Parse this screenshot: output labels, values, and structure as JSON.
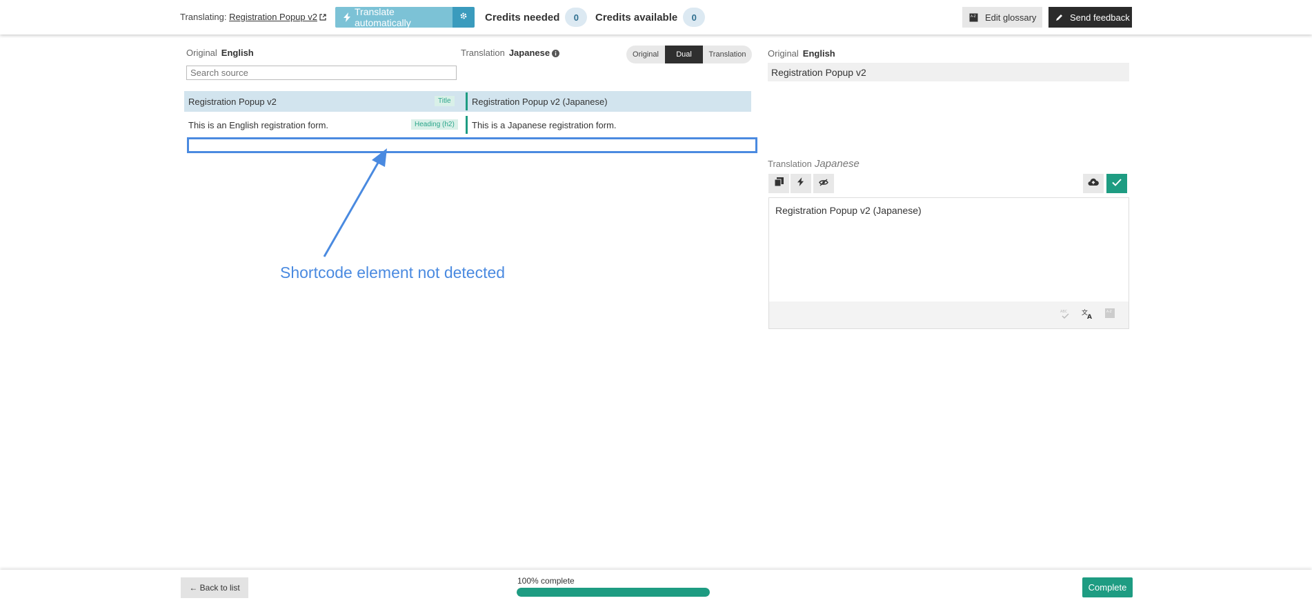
{
  "header": {
    "translating_label": "Translating:",
    "doc_title": "Registration Popup v2",
    "translate_auto_label": "Translate automatically",
    "credits_needed_label": "Credits needed",
    "credits_needed_value": "0",
    "credits_available_label": "Credits available",
    "credits_available_value": "0",
    "edit_glossary_label": "Edit glossary",
    "send_feedback_label": "Send feedback"
  },
  "left_panel": {
    "original_label": "Original",
    "original_lang": "English",
    "translation_label": "Translation",
    "translation_lang": "Japanese",
    "view_modes": [
      "Original",
      "Dual",
      "Translation"
    ],
    "active_view": "Dual",
    "search_placeholder": "Search source",
    "segments": [
      {
        "source": "Registration Popup v2",
        "tag": "Title",
        "target": "Registration Popup v2 (Japanese)",
        "selected": true
      },
      {
        "source": "This is an English registration form.",
        "tag": "Heading (h2)",
        "target": "This is a Japanese registration form.",
        "selected": false
      }
    ],
    "annotation_text": "Shortcode element not detected"
  },
  "right_panel": {
    "original_label": "Original",
    "original_lang": "English",
    "original_text": "Registration Popup v2",
    "translation_label": "Translation",
    "translation_lang": "Japanese",
    "translation_text": "Registration Popup v2 (Japanese)",
    "toolbar_icons": [
      "copy-original-icon",
      "bolt-icon",
      "eye-hide-icon",
      "cloud-upload-icon",
      "check-icon"
    ],
    "footer_icons": [
      "spellcheck-icon",
      "translate-icon",
      "glossary-icon"
    ]
  },
  "footer": {
    "back_label": "← Back to list",
    "progress_label": "100% complete",
    "progress_value": 1.0,
    "complete_label": "Complete"
  },
  "colors": {
    "accent_green": "#1e9c82",
    "accent_blue": "#3a9bbd",
    "auto_button": "#7cc2d6",
    "annotation_blue": "#4a8ae0",
    "selected_row": "#d2e4ee"
  }
}
